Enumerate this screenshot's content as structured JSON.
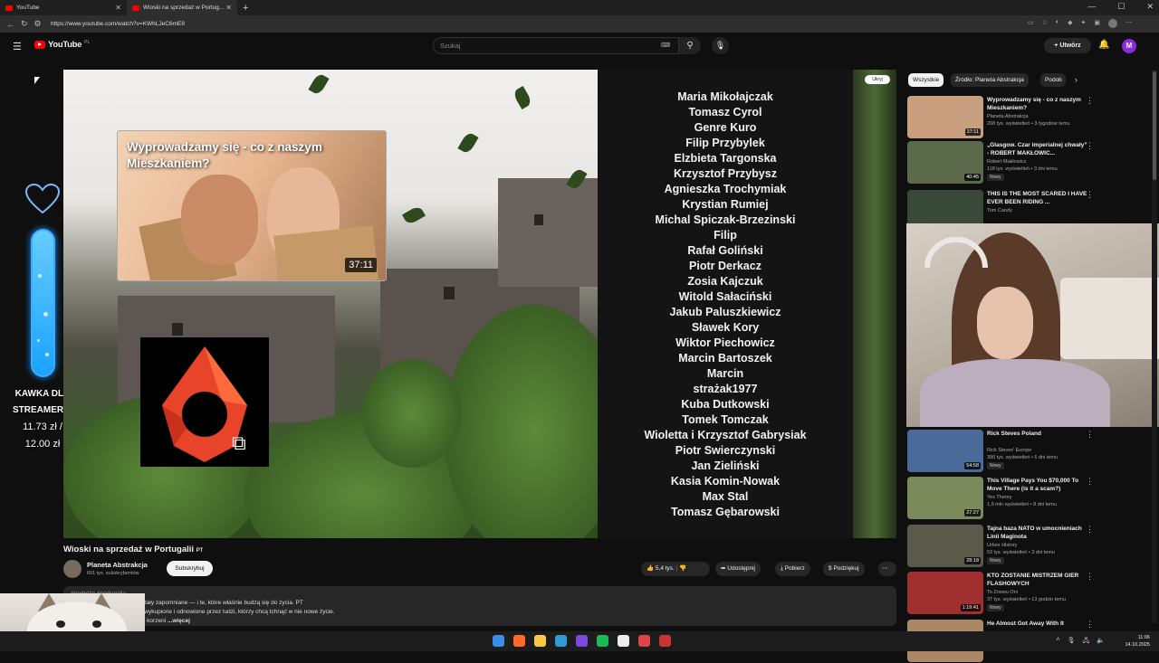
{
  "browser": {
    "tabs": [
      {
        "label": "YouTube",
        "active": false
      },
      {
        "label": "Wioski na sprzedaż w Portug...",
        "active": true
      }
    ],
    "url": "https://www.youtube.com/watch?v=KWhLJeC6mE8"
  },
  "header": {
    "logo": "YouTube",
    "country": "PL",
    "search_placeholder": "Szukaj",
    "create_label": "Utwórz",
    "avatar_letter": "M"
  },
  "overlay": {
    "kawka_line1": "KAWKA DLA",
    "kawka_line2": "STREAMERKI",
    "price1": "11.73 zł /",
    "price2": "12.00 zł"
  },
  "player": {
    "hide_label": "Ukryj",
    "endcard_title": "Wyprowadzamy się - co z naszym Mieszkaniem?",
    "endcard_duration": "37:11",
    "credits": [
      "Maria Mikołajczak",
      "Tomasz Cyrol",
      "Genre Kuro",
      "Filip Przybylek",
      "Elzbieta Targonska",
      "Krzysztof Przybysz",
      "Agnieszka Trochymiak",
      "Krystian Rumiej",
      "Michal Spiczak-Brzezinski",
      "Filip",
      "Rafał Goliński",
      "Piotr Derkacz",
      "Zosia Kajczuk",
      "Witold Sałaciński",
      "Jakub Paluszkiewicz",
      "Sławek Kory",
      "Wiktor Piechowicz",
      "Marcin Bartoszek",
      "Marcin",
      "strażak1977",
      "Kuba Dutkowski",
      "Tomek Tomczak",
      "Wioletta i Krzysztof Gabrysiak",
      "Piotr Swierczynski",
      "Jan Zieliński",
      "Kasia Komin-Nowak",
      "Max Stal",
      "Tomasz Gębarowski"
    ]
  },
  "video": {
    "title": "Wioski na sprzedaż w Portugalii",
    "title_tag": "PT",
    "channel": "Planeta Abstrakcja",
    "subscribers": "601 tys. subskrybentów",
    "subscribe_label": "Subskrybuj",
    "likes": "5,4 tys.",
    "share_label": "Udostępnij",
    "download_label": "Pobierz",
    "thanks_label": "Podziękuj"
  },
  "description": {
    "tags": "#podróże #portugalia",
    "line1": "odkrywając wioski, które zostały zapomniane — i te, które właśnie budzą się do życia. PT",
    "line2": "le opuszczone, inne zostały wykupione i odnowione przez ludzi, którzy chcą tchnąć w nie nowe życie.",
    "line3": "ięć i marzenia o powrocie do korzeni",
    "more": "...więcej"
  },
  "sidebar": {
    "chips": [
      "Wszystkie",
      "Źródło: Planeta Abstrakcja",
      "Podob"
    ],
    "items_top": [
      {
        "title": "Wyprowadzamy się - co z naszym Mieszkaniem?",
        "channel": "Planeta Abstrakcja",
        "meta": "208 tys. wyświetleń • 3 tygodnie temu",
        "duration": "37:11",
        "new": "",
        "thumb": "#c8a080"
      },
      {
        "title": "„Glasgow. Czar imperialnej chwały” - ROBERT MAKŁOWIC...",
        "channel": "Robert Makłowicz",
        "meta": "118 tys. wyświetleń • 3 dni temu",
        "duration": "40:45",
        "new": "Nowy",
        "thumb": "#5a6a4a"
      },
      {
        "title": "THIS IS THE MOST SCARED I HAVE EVER BEEN RIDING ...",
        "channel": "Tom Candy",
        "meta": "",
        "duration": "",
        "new": "",
        "thumb": "#3a4a3a"
      }
    ],
    "items_bottom": [
      {
        "title": "Rick Steves Poland",
        "channel": "Rick Steves' Europe",
        "meta": "390 tys. wyświetleń • 6 dni temu",
        "duration": "54:58",
        "new": "Nowy",
        "thumb": "#4a6a9a"
      },
      {
        "title": "This Village Pays You $70,000 To Move There (is it a scam?)",
        "channel": "Yes Theory",
        "meta": "1,9 mln wyświetleń • 8 dni temu",
        "duration": "27:27",
        "new": "",
        "thumb": "#7a8a5a"
      },
      {
        "title": "Tajna baza NATO w umocnieniach Linii Maginota",
        "channel": "Urbex History",
        "meta": "53 tys. wyświetleń • 3 dni temu",
        "duration": "28:18",
        "new": "Nowy",
        "thumb": "#5a5a4a"
      },
      {
        "title": "KTO ZOSTANIE MISTRZEM GIER FLASHOWYCH",
        "channel": "To Znowu Oni",
        "meta": "37 tys. wyświetleń • 13 godzin temu",
        "duration": "1:19:41",
        "new": "Nowy",
        "thumb": "#a03030"
      },
      {
        "title": "He Almost Got Away With It",
        "channel": "",
        "meta": "",
        "duration": "",
        "new": "",
        "thumb": "#aa8866"
      }
    ]
  },
  "taskbar": {
    "time": "11:06",
    "date": "14.10.2025"
  },
  "colors": {
    "accent": "#ff0000",
    "tube": "#1aa3ff",
    "avatar": "#8a2be2"
  }
}
